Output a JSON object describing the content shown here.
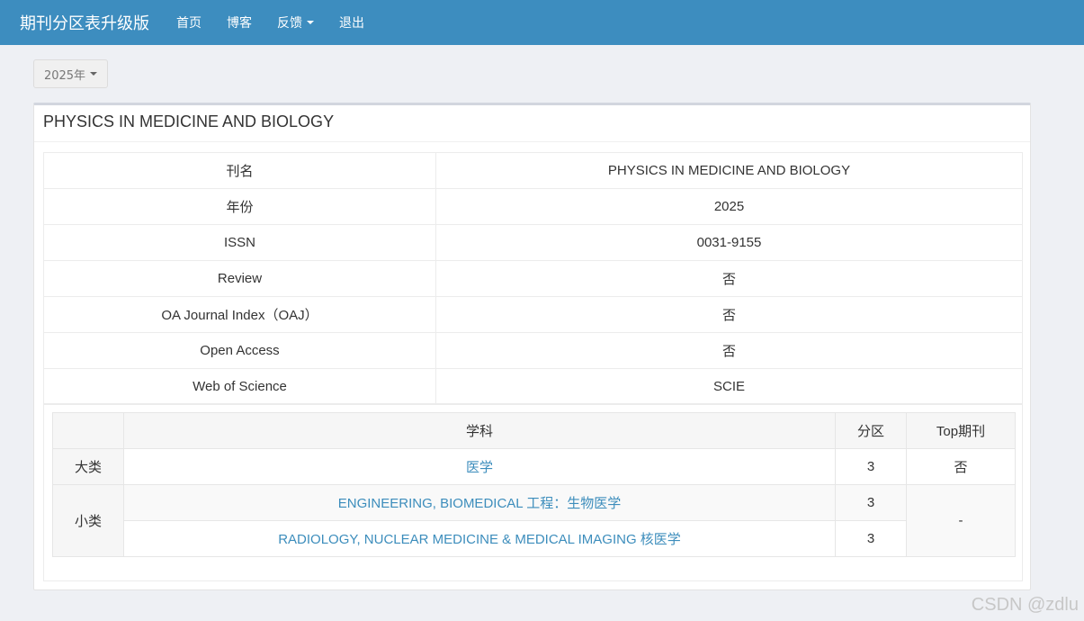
{
  "navbar": {
    "brand": "期刊分区表升级版",
    "items": [
      "首页",
      "博客",
      "反馈",
      "退出"
    ]
  },
  "year_selector": {
    "label": "2025年"
  },
  "panel": {
    "title": "PHYSICS IN MEDICINE AND BIOLOGY"
  },
  "info_table": [
    {
      "key": "刊名",
      "value": "PHYSICS IN MEDICINE AND BIOLOGY"
    },
    {
      "key": "年份",
      "value": "2025"
    },
    {
      "key": "ISSN",
      "value": "0031-9155"
    },
    {
      "key": "Review",
      "value": "否"
    },
    {
      "key": "OA Journal Index（OAJ）",
      "value": "否"
    },
    {
      "key": "Open Access",
      "value": "否"
    },
    {
      "key": "Web of Science",
      "value": "SCIE"
    }
  ],
  "category_table": {
    "headers": {
      "subject": "学科",
      "zone": "分区",
      "top": "Top期刊"
    },
    "major": {
      "label": "大类",
      "subject": "医学",
      "zone": "3",
      "top": "否"
    },
    "minor": {
      "label": "小类",
      "top": "-",
      "rows": [
        {
          "subject": "ENGINEERING, BIOMEDICAL 工程：生物医学",
          "zone": "3"
        },
        {
          "subject": "RADIOLOGY, NUCLEAR MEDICINE & MEDICAL IMAGING 核医学",
          "zone": "3"
        }
      ]
    }
  },
  "watermark": "CSDN @zdlu",
  "colors": {
    "navbar": "#3d8dbf",
    "link": "#3c8dbc",
    "background": "#eef0f4"
  }
}
